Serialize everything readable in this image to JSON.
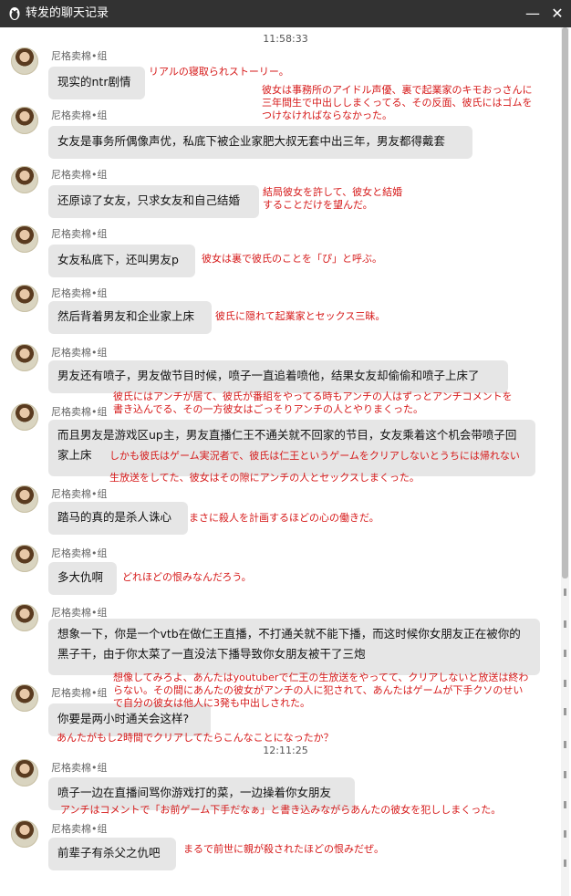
{
  "window": {
    "title": "转发的聊天记录",
    "minimize_label": "—",
    "close_label": "✕"
  },
  "timestamps": [
    "11:58:33",
    "12:11:25"
  ],
  "messages": [
    {
      "sender": "尼格卖棉•组",
      "text": "现实的ntr剧情"
    },
    {
      "sender": "尼格卖棉•组",
      "text": "女友是事务所偶像声优，私底下被企业家肥大叔无套中出三年，男友都得戴套"
    },
    {
      "sender": "尼格卖棉•组",
      "text": "还原谅了女友，只求女友和自己结婚"
    },
    {
      "sender": "尼格卖棉•组",
      "text": "女友私底下，还叫男友p"
    },
    {
      "sender": "尼格卖棉•组",
      "text": "然后背着男友和企业家上床"
    },
    {
      "sender": "尼格卖棉•组",
      "text": "男友还有喷子，男友做节目时候，喷子一直追着喷他，结果女友却偷偷和喷子上床了"
    },
    {
      "sender": "尼格卖棉•组",
      "text": "而且男友是游戏区up主，男友直播仁王不通关就不回家的节目，女友乘着这个机会带喷子回家上床"
    },
    {
      "sender": "尼格卖棉•组",
      "text": "踏马的真的是杀人诛心"
    },
    {
      "sender": "尼格卖棉•组",
      "text": "多大仇啊"
    },
    {
      "sender": "尼格卖棉•组",
      "text": "想象一下，你是一个vtb在做仁王直播，不打通关就不能下播，而这时候你女朋友正在被你的黑子干，由于你太菜了一直没法下播导致你女朋友被干了三炮"
    },
    {
      "sender": "尼格卖棉•组",
      "text": "你要是两小时通关会这样?"
    },
    {
      "sender": "尼格卖棉•组",
      "text": "喷子一边在直播间骂你游戏打的菜，一边操着你女朋友"
    },
    {
      "sender": "尼格卖棉•组",
      "text": "前辈子有杀父之仇吧"
    }
  ],
  "annotations": [
    {
      "text": "リアルの寝取られストーリー。"
    },
    {
      "text": "彼女は事務所のアイドル声優、裏で起業家のキモおっさんに\n三年間生で中出ししまくってる、その反面、彼氏にはゴムを\nつけなければならなかった。"
    },
    {
      "text": "結局彼女を許して、彼女と結婚\nすることだけを望んだ。"
    },
    {
      "text": "彼女は裏で彼氏のことを「ぴ」と呼ぶ。"
    },
    {
      "text": "彼氏に隠れて起業家とセックス三昧。"
    },
    {
      "text": "彼氏にはアンチが居て、彼氏が番組をやってる時もアンチの人はずっとアンチコメントを\n書き込んでる、その一方彼女はごっそりアンチの人とやりまくった。"
    },
    {
      "text": "しかも彼氏はゲーム実況者で、彼氏は仁王というゲームをクリアしないとうちには帰れない"
    },
    {
      "text": "生放送をしてた、彼女はその隙にアンチの人とセックスしまくった。"
    },
    {
      "text": "まさに殺人を計画するほどの心の働きだ。"
    },
    {
      "text": "どれほどの恨みなんだろう。"
    },
    {
      "text": "想像してみろよ、あんたはyoutuberで仁王の生放送をやってて、クリアしないと放送は終わ\nらない。その間にあんたの彼女がアンチの人に犯されて、あんたはゲームが下手クソのせい\nで自分の彼女は他人に3発も中出しされた。"
    },
    {
      "text": "あんたがもし2時間でクリアしてたらこんなことになったか？"
    },
    {
      "text": "アンチはコメントで「お前ゲーム下手だなぁ」と書き込みながらあんたの彼女を犯ししまくった。"
    },
    {
      "text": "まるで前世に親が殺されたほどの恨みだぜ。"
    }
  ]
}
